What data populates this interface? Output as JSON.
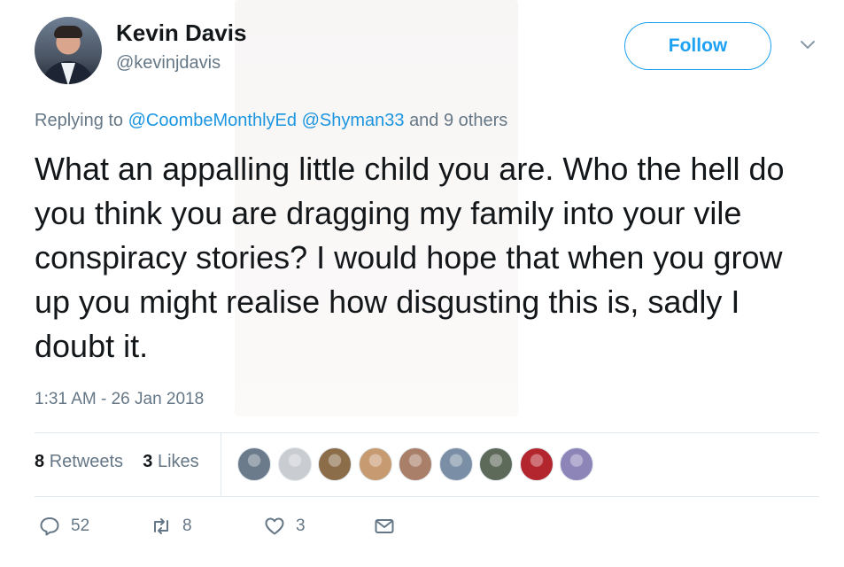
{
  "user": {
    "name": "Kevin Davis",
    "handle": "@kevinjdavis"
  },
  "follow_label": "Follow",
  "reply": {
    "prefix": "Replying to",
    "mention1": "@CoombeMonthlyEd",
    "mention2": "@Shyman33",
    "suffix": "and 9 others"
  },
  "tweet_text": "What an appalling little child you are. Who the hell do you think you are dragging my family into your vile conspiracy stories? I would hope that when you grow up you might realise how disgusting this is, sadly I doubt it.",
  "timestamp": "1:31 AM - 26 Jan 2018",
  "stats": {
    "retweets_count": "8",
    "retweets_label": "Retweets",
    "likes_count": "3",
    "likes_label": "Likes"
  },
  "liker_avatars": [
    {
      "color": "#6b7b8c",
      "icon": "avatar-photo"
    },
    {
      "color": "#c9ccd1",
      "icon": "default-avatar"
    },
    {
      "color": "#8b6d4a",
      "icon": "avatar-otter"
    },
    {
      "color": "#c79a72",
      "icon": "avatar-photo"
    },
    {
      "color": "#a97f6a",
      "icon": "avatar-photo"
    },
    {
      "color": "#7a8fa5",
      "icon": "avatar-photo"
    },
    {
      "color": "#5d6a5a",
      "icon": "avatar-photo"
    },
    {
      "color": "#b3262e",
      "icon": "avatar-union-jack"
    },
    {
      "color": "#8d84b8",
      "icon": "avatar-photo"
    }
  ],
  "actions": {
    "replies": "52",
    "retweets": "8",
    "likes": "3"
  },
  "colors": {
    "accent": "#1da1f2",
    "link": "#1b95e0",
    "muted": "#657786",
    "text": "#14171a"
  }
}
